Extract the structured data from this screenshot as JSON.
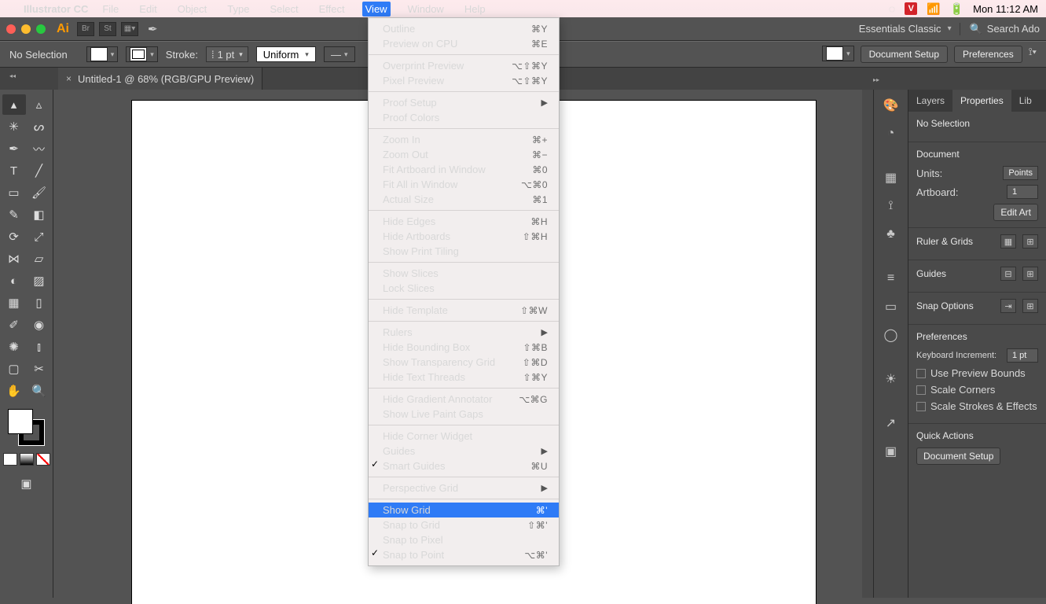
{
  "menubar": {
    "app": "Illustrator CC",
    "items": [
      "File",
      "Edit",
      "Object",
      "Type",
      "Select",
      "Effect",
      "View",
      "Window",
      "Help"
    ],
    "active": "View",
    "clock": "Mon 11:12 AM"
  },
  "approw": {
    "workspace": "Essentials Classic",
    "search_placeholder": "Search Ado"
  },
  "ctrlbar": {
    "selection": "No Selection",
    "stroke_label": "Stroke:",
    "stroke_value": "1 pt",
    "profile": "Uniform",
    "doc_setup": "Document Setup",
    "prefs": "Preferences"
  },
  "doc": {
    "tab": "Untitled-1 @ 68% (RGB/GPU Preview)"
  },
  "menu": {
    "items": [
      {
        "t": "group",
        "items": [
          {
            "label": "Outline",
            "sc": "⌘Y"
          },
          {
            "label": "Preview on CPU",
            "sc": "⌘E"
          }
        ]
      },
      {
        "t": "group",
        "items": [
          {
            "label": "Overprint Preview",
            "sc": "⌥⇧⌘Y"
          },
          {
            "label": "Pixel Preview",
            "sc": "⌥⇧⌘Y"
          }
        ]
      },
      {
        "t": "group",
        "items": [
          {
            "label": "Proof Setup",
            "sub": true
          },
          {
            "label": "Proof Colors"
          }
        ]
      },
      {
        "t": "group",
        "items": [
          {
            "label": "Zoom In",
            "sc": "⌘+"
          },
          {
            "label": "Zoom Out",
            "sc": "⌘−"
          },
          {
            "label": "Fit Artboard in Window",
            "sc": "⌘0"
          },
          {
            "label": "Fit All in Window",
            "sc": "⌥⌘0"
          },
          {
            "label": "Actual Size",
            "sc": "⌘1"
          }
        ]
      },
      {
        "t": "group",
        "items": [
          {
            "label": "Hide Edges",
            "sc": "⌘H"
          },
          {
            "label": "Hide Artboards",
            "sc": "⇧⌘H"
          },
          {
            "label": "Show Print Tiling"
          }
        ]
      },
      {
        "t": "group",
        "items": [
          {
            "label": "Show Slices"
          },
          {
            "label": "Lock Slices"
          }
        ]
      },
      {
        "t": "group",
        "items": [
          {
            "label": "Hide Template",
            "sc": "⇧⌘W",
            "dis": true
          }
        ]
      },
      {
        "t": "group",
        "items": [
          {
            "label": "Rulers",
            "sub": true
          },
          {
            "label": "Hide Bounding Box",
            "sc": "⇧⌘B"
          },
          {
            "label": "Show Transparency Grid",
            "sc": "⇧⌘D"
          },
          {
            "label": "Hide Text Threads",
            "sc": "⇧⌘Y"
          }
        ]
      },
      {
        "t": "group",
        "items": [
          {
            "label": "Hide Gradient Annotator",
            "sc": "⌥⌘G"
          },
          {
            "label": "Show Live Paint Gaps"
          }
        ]
      },
      {
        "t": "group",
        "items": [
          {
            "label": "Hide Corner Widget"
          },
          {
            "label": "Guides",
            "sub": true
          },
          {
            "label": "Smart Guides",
            "sc": "⌘U",
            "chk": true
          }
        ]
      },
      {
        "t": "group",
        "items": [
          {
            "label": "Perspective Grid",
            "sub": true
          }
        ]
      },
      {
        "t": "group",
        "items": [
          {
            "label": "Show Grid",
            "sc": "⌘'",
            "hl": true
          },
          {
            "label": "Snap to Grid",
            "sc": "⇧⌘'"
          },
          {
            "label": "Snap to Pixel"
          },
          {
            "label": "Snap to Point",
            "sc": "⌥⌘'",
            "chk": true
          }
        ]
      }
    ]
  },
  "panel": {
    "tabs": [
      "Layers",
      "Properties",
      "Lib"
    ],
    "active": "Properties",
    "nosel": "No Selection",
    "doc_header": "Document",
    "units_lbl": "Units:",
    "units_val": "Points",
    "artb_lbl": "Artboard:",
    "artb_val": "1",
    "edit_art": "Edit Art",
    "ruler_header": "Ruler & Grids",
    "guides_header": "Guides",
    "snap_header": "Snap Options",
    "prefs_header": "Preferences",
    "kbd_lbl": "Keyboard Increment:",
    "kbd_val": "1 pt",
    "chk1": "Use Preview Bounds",
    "chk2": "Scale Corners",
    "chk3": "Scale Strokes & Effects",
    "quick": "Quick Actions",
    "qbtn": "Document Setup"
  }
}
